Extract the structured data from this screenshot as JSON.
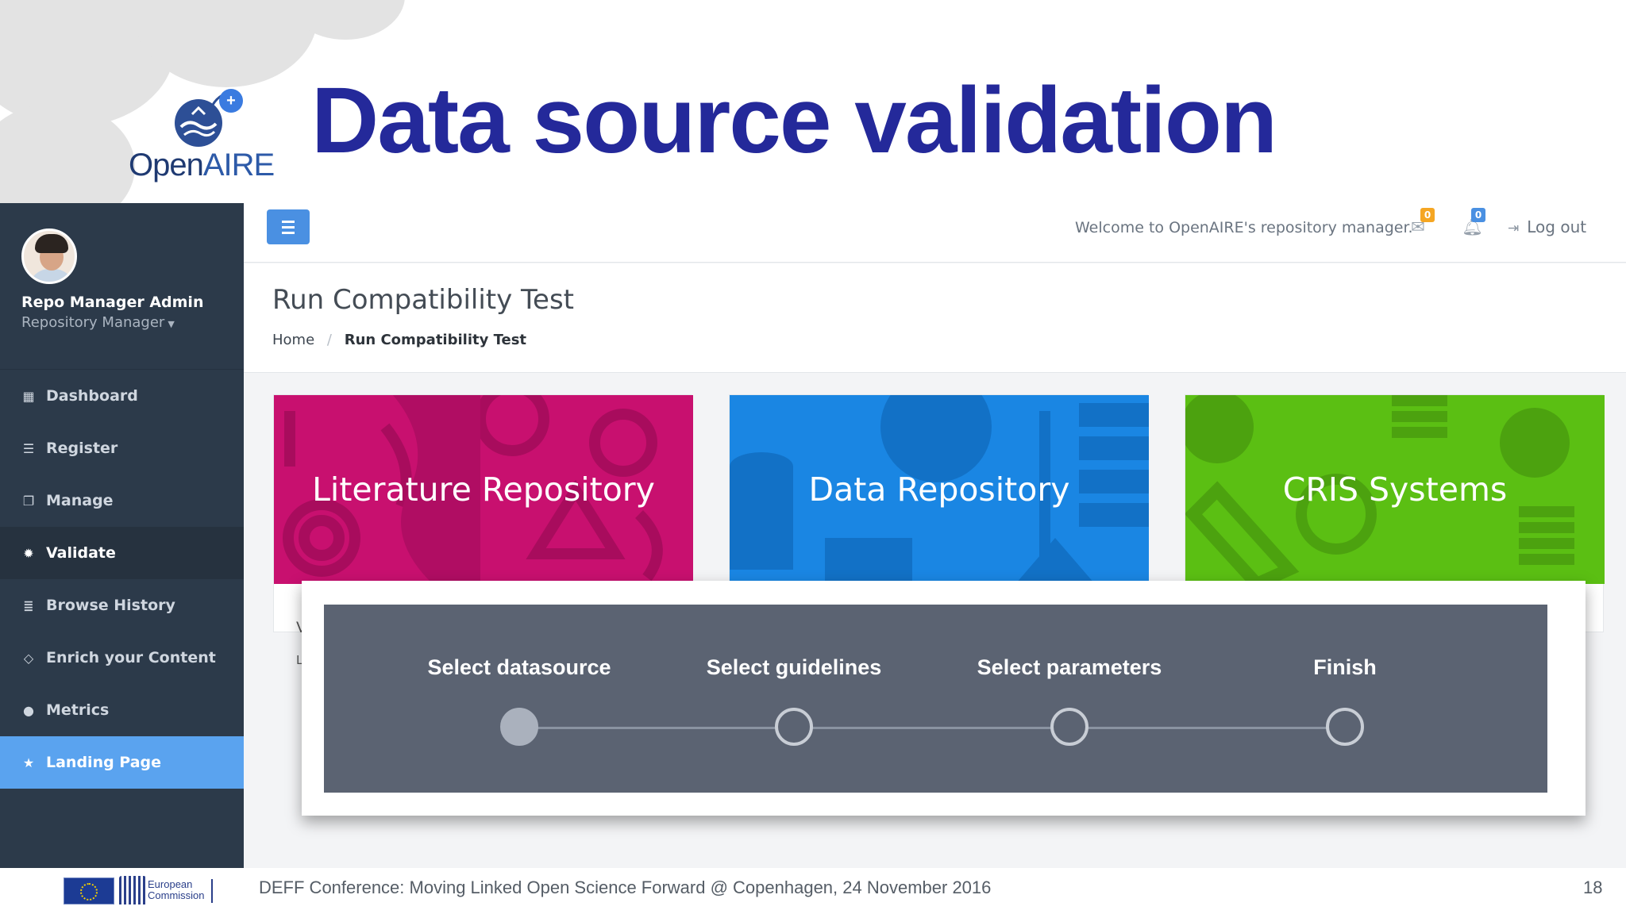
{
  "slide": {
    "title": "Data source validation",
    "logo": {
      "text_main": "Open",
      "text_accent": "AIRE"
    }
  },
  "topbar": {
    "welcome": "Welcome to OpenAIRE's repository manager.",
    "mail_count": "0",
    "notification_count": "0",
    "logout_label": "Log out",
    "colors": {
      "menu_button": "#4a90e2",
      "mail_badge": "#f5a623",
      "notification_badge": "#4a90e2"
    }
  },
  "sidebar": {
    "user_name": "Repo Manager Admin",
    "user_role": "Repository Manager",
    "items": [
      {
        "label": "Dashboard",
        "icon": "dashboard-icon",
        "state": "normal"
      },
      {
        "label": "Register",
        "icon": "database-icon",
        "state": "normal"
      },
      {
        "label": "Manage",
        "icon": "manage-icon",
        "state": "normal"
      },
      {
        "label": "Validate",
        "icon": "gear-icon",
        "state": "current"
      },
      {
        "label": "Browse History",
        "icon": "list-icon",
        "state": "normal"
      },
      {
        "label": "Enrich your Content",
        "icon": "diamond-icon",
        "state": "normal"
      },
      {
        "label": "Metrics",
        "icon": "globe-icon",
        "state": "normal"
      },
      {
        "label": "Landing Page",
        "icon": "star-icon",
        "state": "active"
      }
    ]
  },
  "page": {
    "title": "Run Compatibility Test",
    "breadcrumb": {
      "home": "Home",
      "current": "Run Compatibility Test"
    }
  },
  "cards": [
    {
      "title": "Literature Repository",
      "color": "#c8106f",
      "text_start": "V",
      "text_start2": "L"
    },
    {
      "title": "Data Repository",
      "color": "#1a86e3"
    },
    {
      "title": "CRIS Systems",
      "color": "#5bbf13"
    }
  ],
  "wizard": {
    "steps": [
      {
        "label": "Select datasource",
        "done": true
      },
      {
        "label": "Select guidelines",
        "done": false
      },
      {
        "label": "Select parameters",
        "done": false
      },
      {
        "label": "Finish",
        "done": false
      }
    ]
  },
  "footer": {
    "eu_text_line1": "European",
    "eu_text_line2": "Commission",
    "text": "DEFF Conference: Moving Linked Open Science Forward @ Copenhagen, 24 November 2016",
    "page_number": "18"
  }
}
